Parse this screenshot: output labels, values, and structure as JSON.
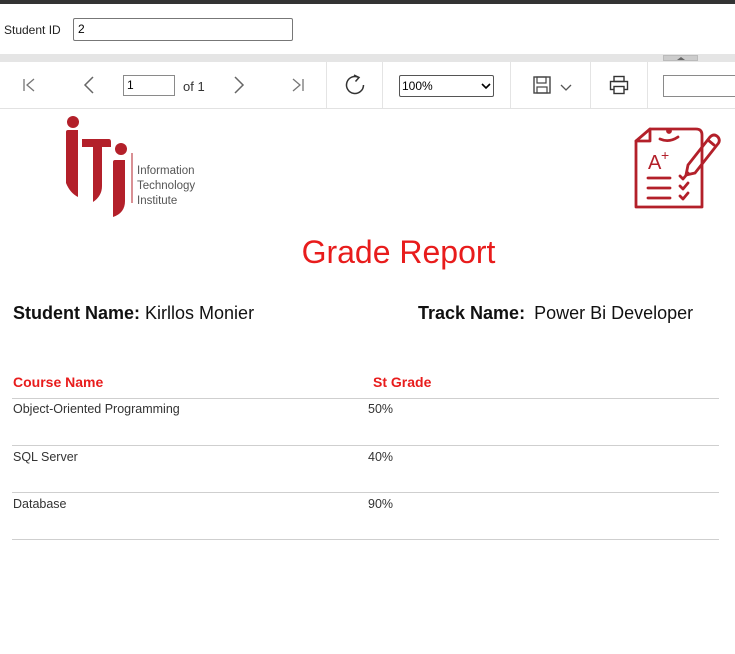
{
  "parameters": {
    "student_id_label": "Student ID",
    "student_id_value": "2"
  },
  "toolbar": {
    "page_current": "1",
    "page_of": "of 1",
    "zoom": "100%"
  },
  "logo": {
    "line1": "Information",
    "line2": "Technology",
    "line3": "Institute"
  },
  "report": {
    "title": "Grade Report",
    "student_name_label": "Student Name:",
    "student_name": "Kirllos Monier",
    "track_name_label": "Track Name:",
    "track_name": "Power Bi Developer",
    "columns": [
      "Course Name",
      "St Grade"
    ],
    "rows": [
      {
        "course": "Object-Oriented Programming",
        "grade": "50%"
      },
      {
        "course": "SQL Server",
        "grade": "40%"
      },
      {
        "course": "Database",
        "grade": "90%"
      }
    ]
  },
  "colors": {
    "accent": "#e81c1c",
    "brand_red": "#b3202a"
  }
}
